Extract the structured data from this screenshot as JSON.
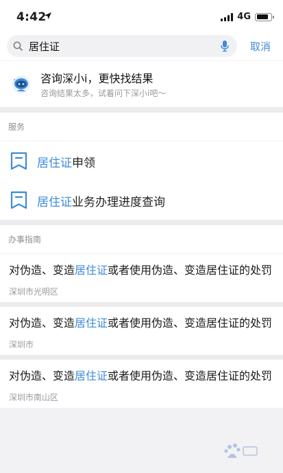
{
  "status_bar": {
    "time": "4:42",
    "network": "4G",
    "battery_level": 0.8
  },
  "search": {
    "query": "居住证",
    "cancel_label": "取消"
  },
  "assistant": {
    "title": "咨询深小i，更快找结果",
    "subtitle": "咨询结果太多，试着问下深小i吧～"
  },
  "services": {
    "header": "服务",
    "items": [
      {
        "highlight": "居住证",
        "rest": "申领"
      },
      {
        "highlight": "居住证",
        "rest": "业务办理进度查询"
      }
    ]
  },
  "guides": {
    "header": "办事指南",
    "items": [
      {
        "pre": "对伪造、变造",
        "highlight": "居住证",
        "post": "或者使用伪造、变造居住证的处罚",
        "location": "深圳市光明区"
      },
      {
        "pre": "对伪造、变造",
        "highlight": "居住证",
        "post": "或者使用伪造、变造居住证的处罚",
        "location": "深圳市"
      },
      {
        "pre": "对伪造、变造",
        "highlight": "居住证",
        "post": "或者使用伪造、变造居住证的处罚",
        "location": "深圳市南山区"
      }
    ]
  },
  "colors": {
    "accent": "#3d8bd9",
    "background": "#f2f2f4"
  },
  "icons": [
    "location-arrow-icon",
    "signal-icon",
    "battery-icon",
    "search-icon",
    "mic-icon",
    "robot-icon",
    "bookmark-icon",
    "baidu-watermark"
  ]
}
